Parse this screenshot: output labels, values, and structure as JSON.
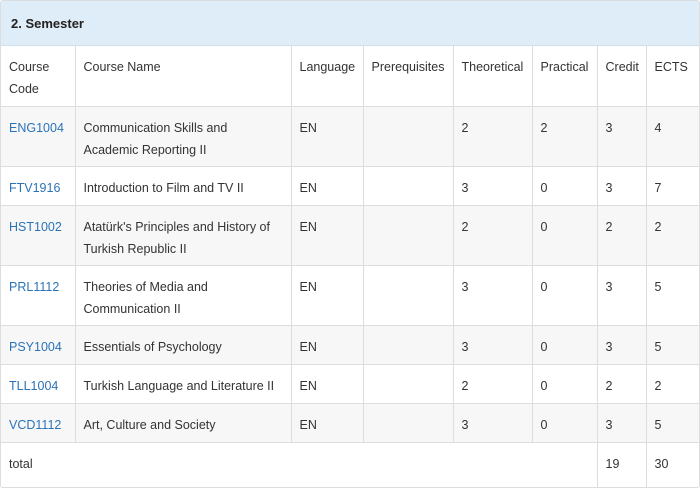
{
  "semester_title": "2. Semester",
  "columns": [
    "Course Code",
    "Course Name",
    "Language",
    "Prerequisites",
    "Theoretical",
    "Practical",
    "Credit",
    "ECTS"
  ],
  "courses": [
    {
      "code": "ENG1004",
      "name": "Communication Skills and Academic Reporting II",
      "language": "EN",
      "prerequisites": "",
      "theoretical": "2",
      "practical": "2",
      "credit": "3",
      "ects": "4"
    },
    {
      "code": "FTV1916",
      "name": "Introduction to Film and TV II",
      "language": "EN",
      "prerequisites": "",
      "theoretical": "3",
      "practical": "0",
      "credit": "3",
      "ects": "7"
    },
    {
      "code": "HST1002",
      "name": "Atatürk's Principles and History of Turkish Republic II",
      "language": "EN",
      "prerequisites": "",
      "theoretical": "2",
      "practical": "0",
      "credit": "2",
      "ects": "2"
    },
    {
      "code": "PRL1112",
      "name": "Theories of Media and Communication II",
      "language": "EN",
      "prerequisites": "",
      "theoretical": "3",
      "practical": "0",
      "credit": "3",
      "ects": "5"
    },
    {
      "code": "PSY1004",
      "name": "Essentials of Psychology",
      "language": "EN",
      "prerequisites": "",
      "theoretical": "3",
      "practical": "0",
      "credit": "3",
      "ects": "5"
    },
    {
      "code": "TLL1004",
      "name": "Turkish Language and Literature II",
      "language": "EN",
      "prerequisites": "",
      "theoretical": "2",
      "practical": "0",
      "credit": "2",
      "ects": "2"
    },
    {
      "code": "VCD1112",
      "name": "Art, Culture and Society",
      "language": "EN",
      "prerequisites": "",
      "theoretical": "3",
      "practical": "0",
      "credit": "3",
      "ects": "5"
    }
  ],
  "total": {
    "label": "total",
    "credit": "19",
    "ects": "30"
  }
}
